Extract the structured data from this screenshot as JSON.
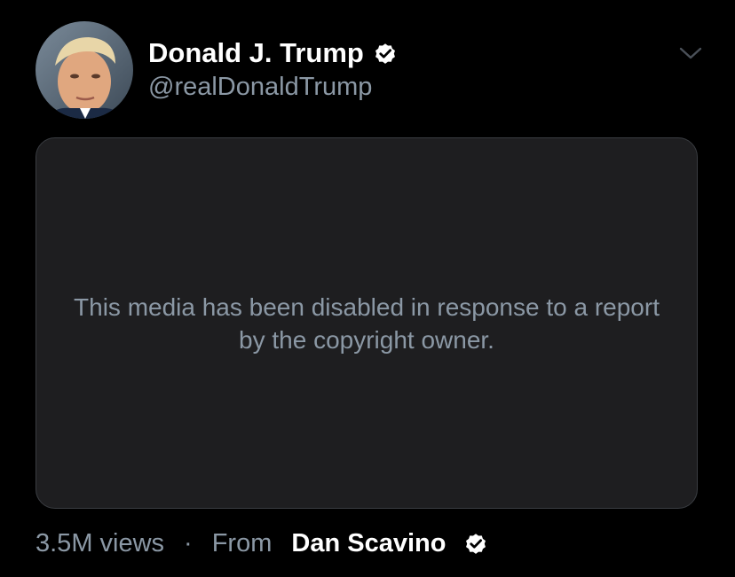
{
  "author": {
    "display_name": "Donald J. Trump",
    "handle": "@realDonaldTrump",
    "verified": true
  },
  "icons": {
    "verified": "verified-badge-icon",
    "menu": "chevron-down-icon"
  },
  "media": {
    "message": "This media has been disabled in response to a report by the copyright owner."
  },
  "footer": {
    "views": "3.5M views",
    "separator": "·",
    "from_label": "From",
    "source_name": "Dan Scavino",
    "source_verified": true
  },
  "colors": {
    "background": "#000000",
    "card": "#1e1e20",
    "secondary_text": "#8b98a5",
    "primary_text": "#ffffff"
  }
}
